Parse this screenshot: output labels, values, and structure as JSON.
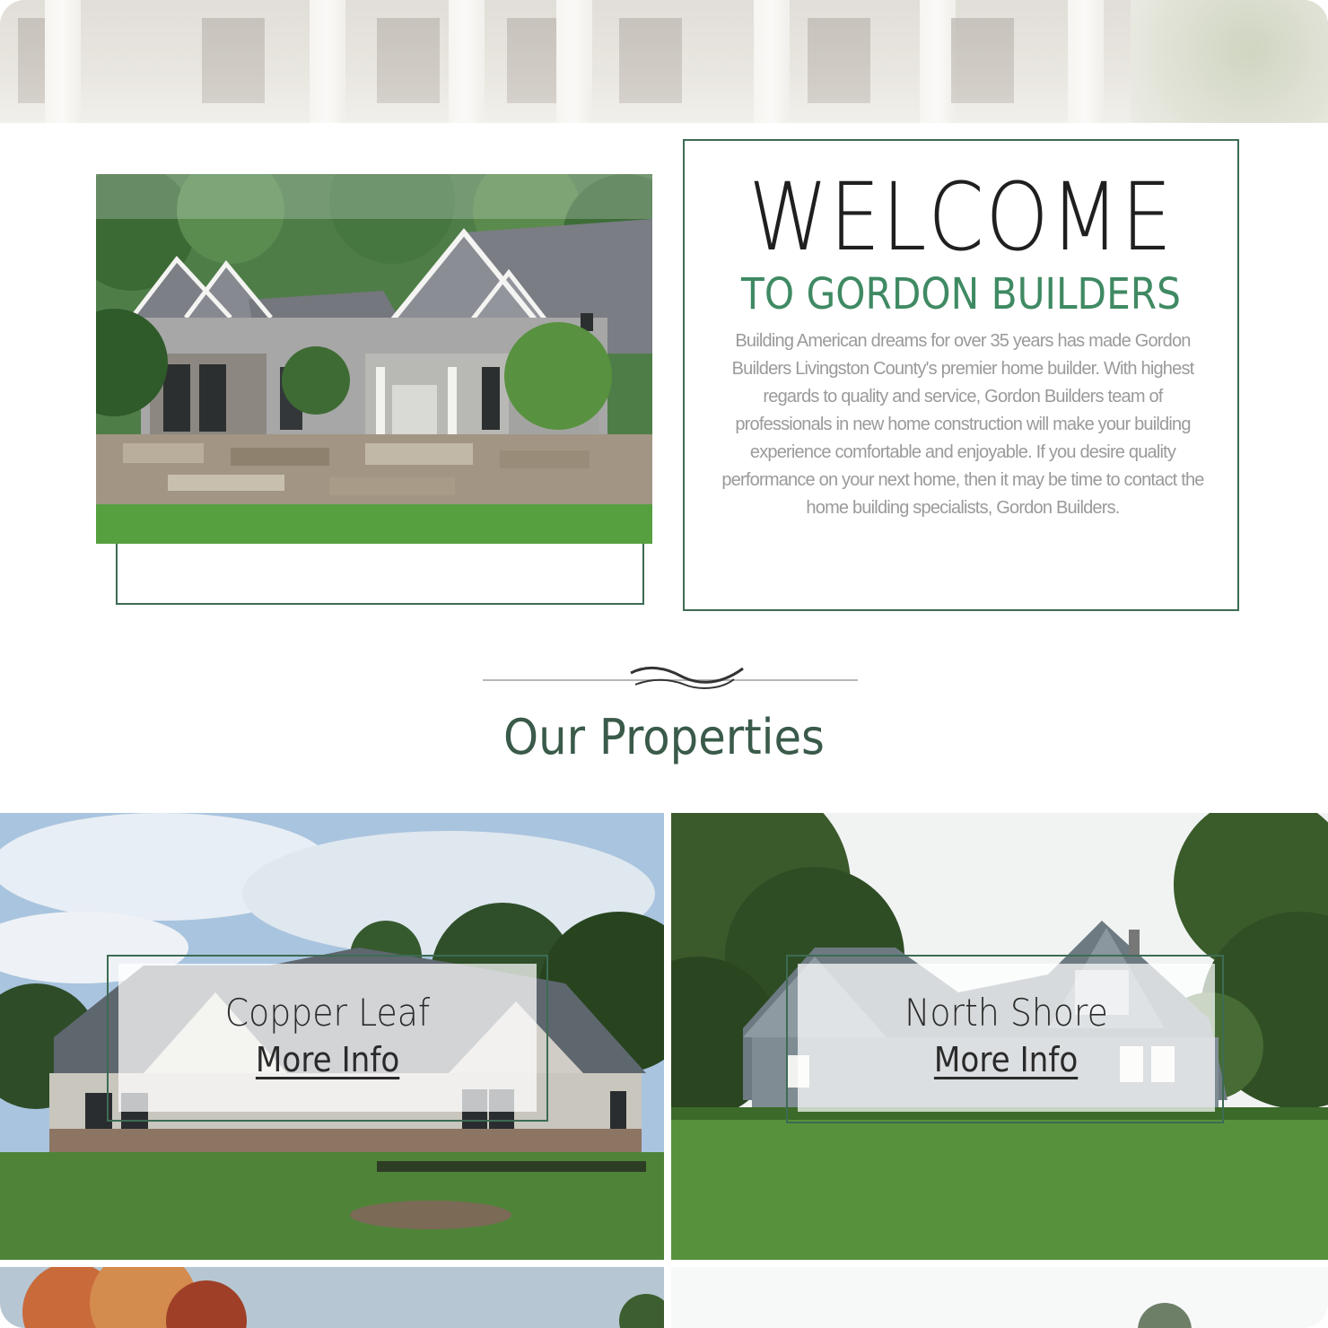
{
  "welcome": {
    "title": "WELCOME",
    "subtitle": "TO GORDON BUILDERS",
    "body": "Building American dreams for over 35 years has made Gordon Builders Livingston County's premier home builder. With highest regards to quality and service, Gordon Builders team of professionals in new home construction will make your building experience comfortable and enjoyable. If you desire quality performance on your next home, then it may be time to contact the home building specialists, Gordon Builders."
  },
  "properties": {
    "heading": "Our Properties",
    "items": [
      {
        "name": "Copper Leaf",
        "link": "More Info"
      },
      {
        "name": "North Shore",
        "link": "More Info"
      }
    ]
  },
  "colors": {
    "accent_green": "#3f8a63",
    "outline_green": "#3d6b54",
    "heading_dark": "#1f1f1f"
  }
}
